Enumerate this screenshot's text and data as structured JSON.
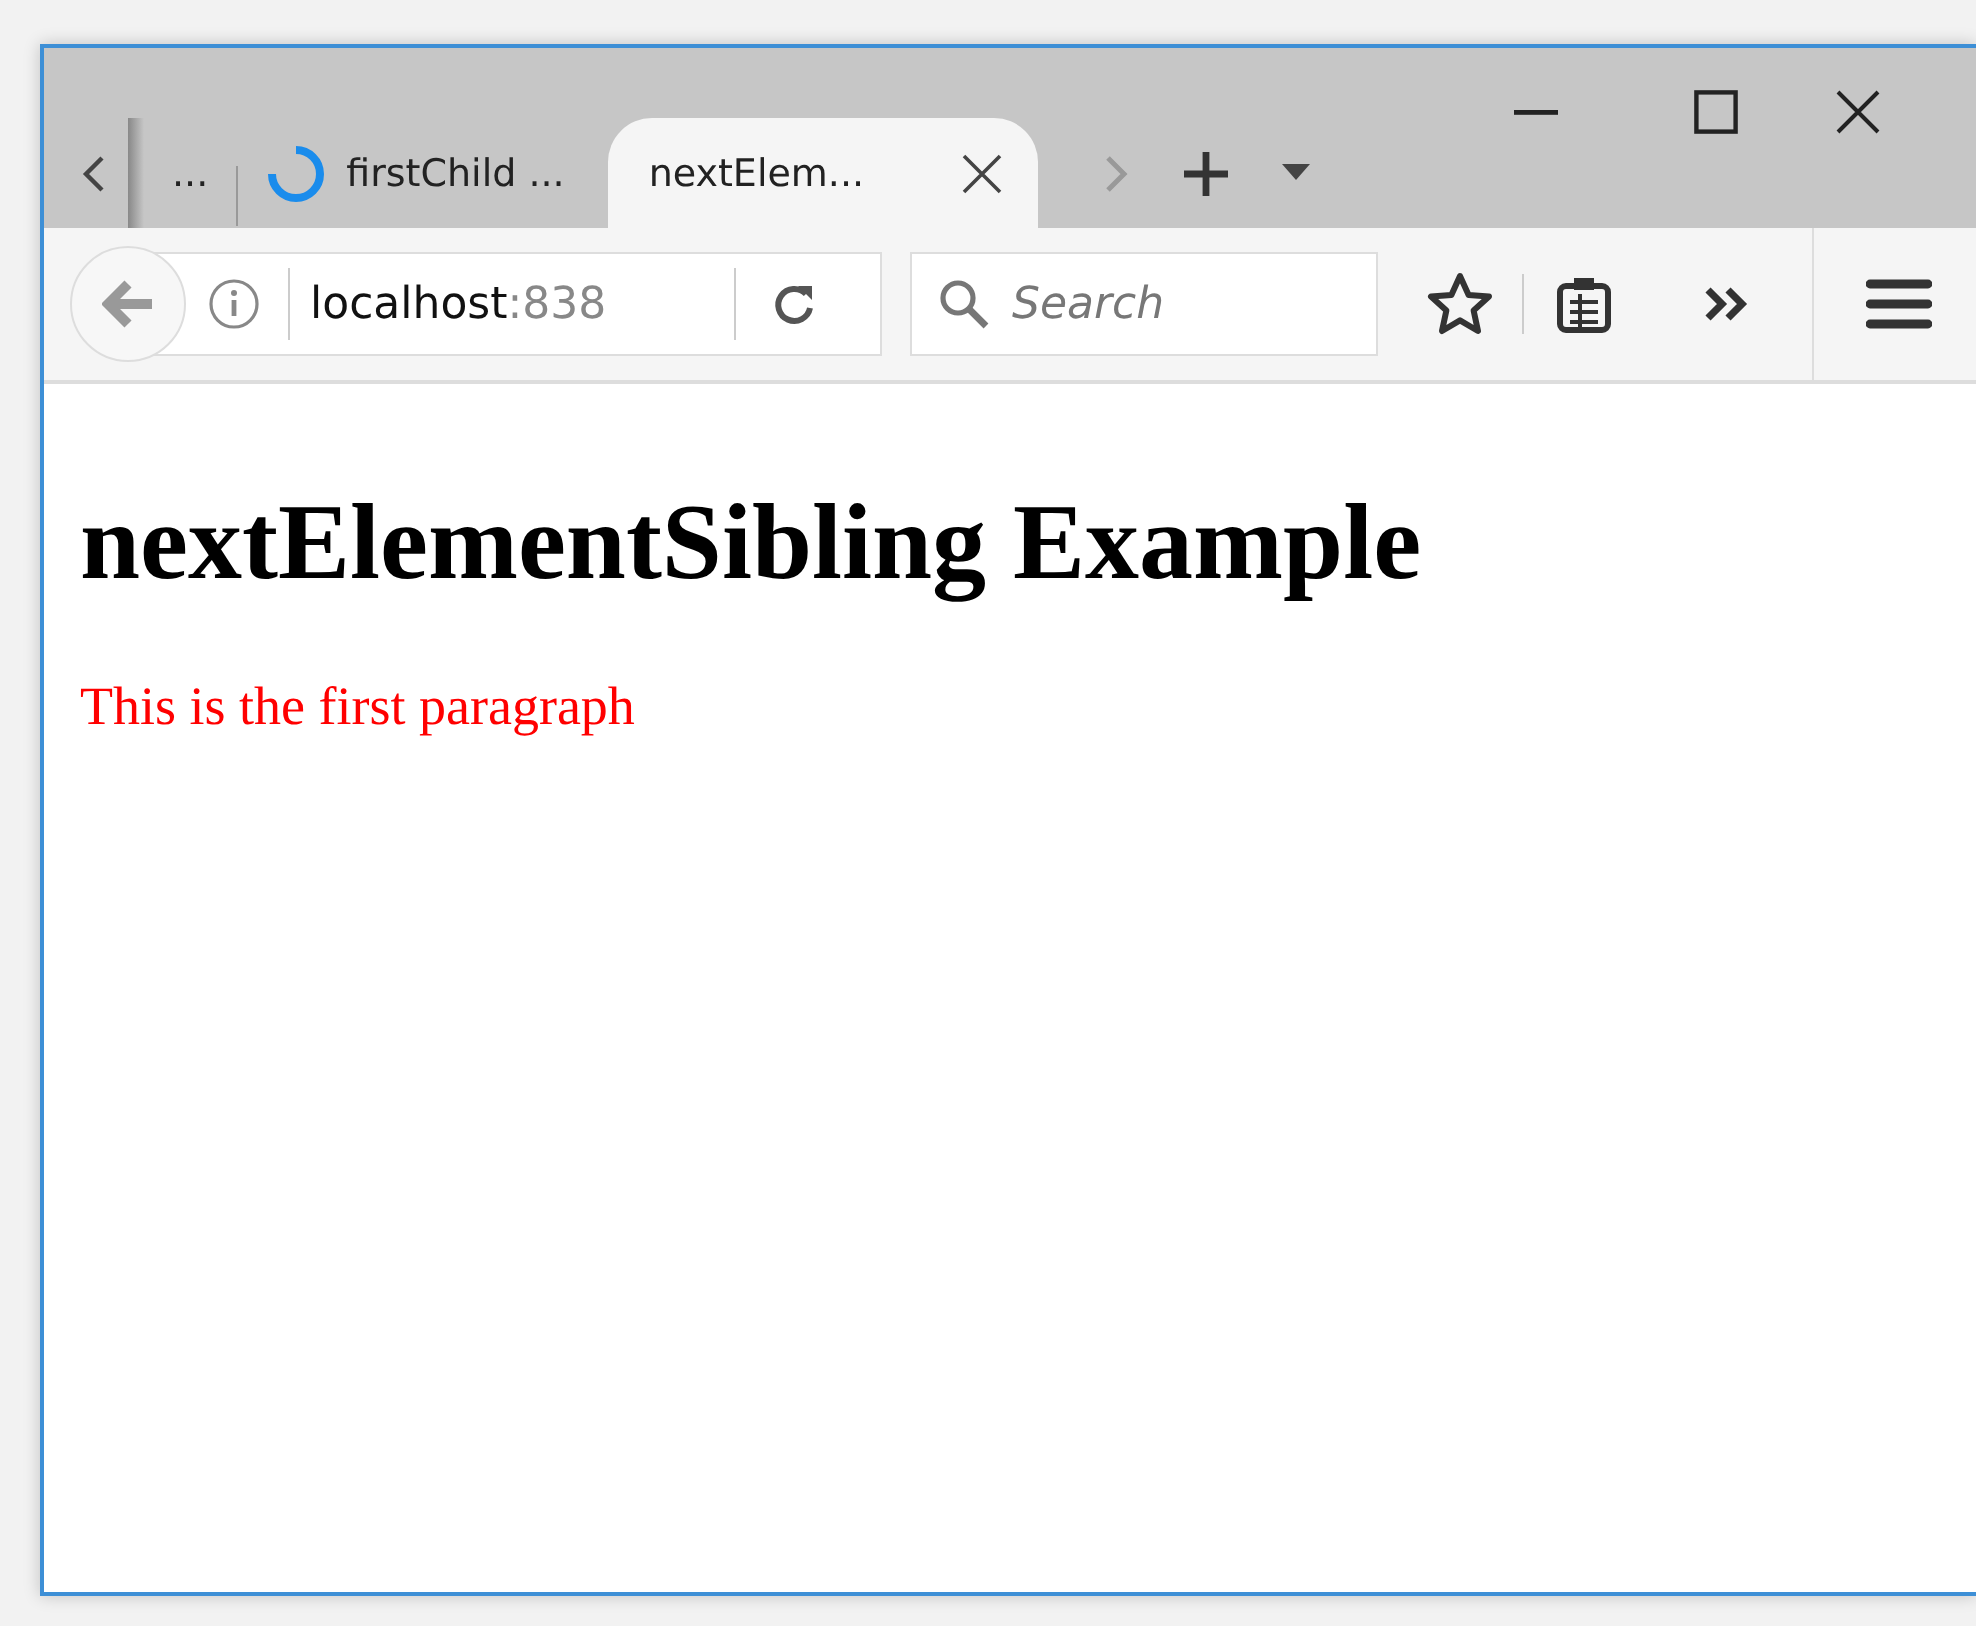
{
  "tabs": [
    {
      "label": "...",
      "selected": false,
      "loading": false
    },
    {
      "label": "firstChild ...",
      "selected": false,
      "loading": true
    },
    {
      "label": "nextElem...",
      "selected": true,
      "loading": false
    }
  ],
  "address": {
    "host": "localhost",
    "port": ":838"
  },
  "search": {
    "placeholder": "Search"
  },
  "page": {
    "heading": "nextElementSibling Example",
    "paragraph": "This is the first paragraph"
  }
}
